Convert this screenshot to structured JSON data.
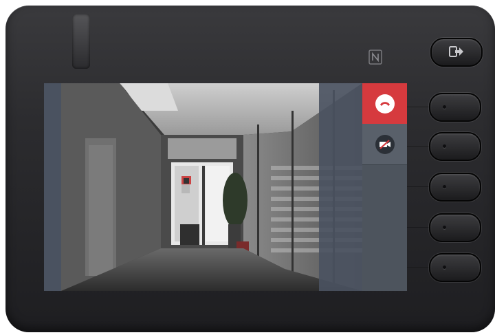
{
  "device": {
    "nfc_icon": "nfc-icon",
    "logout_icon": "logout-icon"
  },
  "video_call": {
    "end_call_icon": "hangup-icon",
    "camera_icon": "camera-off-icon",
    "accent_color": "#d63a3e",
    "sidebar_color": "#4d545d"
  },
  "line_keys": [
    {
      "id": 1
    },
    {
      "id": 2
    },
    {
      "id": 3
    },
    {
      "id": 4
    },
    {
      "id": 5
    }
  ]
}
